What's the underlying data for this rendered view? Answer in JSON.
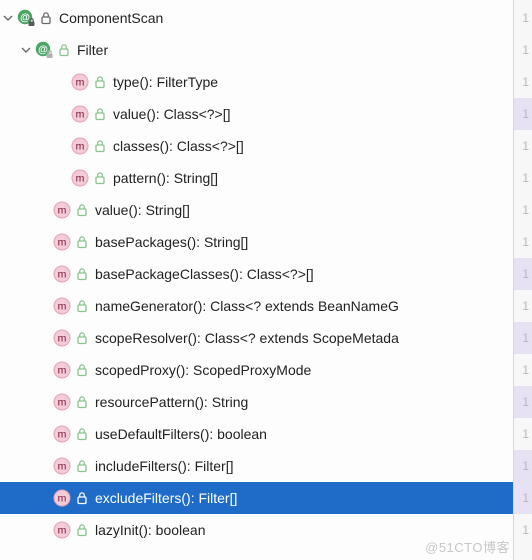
{
  "colors": {
    "selection": "#1e6cc7"
  },
  "gutter_char": "1",
  "watermark": "@51CTO博客",
  "nodes": [
    {
      "indent": 0,
      "caret": "down",
      "kind": "annotation",
      "lock_style": "dark",
      "label": "ComponentScan",
      "selected": false,
      "gutter_hl": false
    },
    {
      "indent": 1,
      "caret": "down",
      "kind": "annotation",
      "lock_style": "light",
      "label": "Filter",
      "selected": false,
      "gutter_hl": false
    },
    {
      "indent": 3,
      "caret": "none",
      "kind": "method",
      "lock_style": "light",
      "label": "type(): FilterType",
      "selected": false,
      "gutter_hl": false
    },
    {
      "indent": 3,
      "caret": "none",
      "kind": "method",
      "lock_style": "light",
      "label": "value(): Class<?>[]",
      "selected": false,
      "gutter_hl": true
    },
    {
      "indent": 3,
      "caret": "none",
      "kind": "method",
      "lock_style": "light",
      "label": "classes(): Class<?>[]",
      "selected": false,
      "gutter_hl": false
    },
    {
      "indent": 3,
      "caret": "none",
      "kind": "method",
      "lock_style": "light",
      "label": "pattern(): String[]",
      "selected": false,
      "gutter_hl": false
    },
    {
      "indent": 2,
      "caret": "none",
      "kind": "method",
      "lock_style": "light",
      "label": "value(): String[]",
      "selected": false,
      "gutter_hl": false
    },
    {
      "indent": 2,
      "caret": "none",
      "kind": "method",
      "lock_style": "light",
      "label": "basePackages(): String[]",
      "selected": false,
      "gutter_hl": false
    },
    {
      "indent": 2,
      "caret": "none",
      "kind": "method",
      "lock_style": "light",
      "label": "basePackageClasses(): Class<?>[]",
      "selected": false,
      "gutter_hl": true
    },
    {
      "indent": 2,
      "caret": "none",
      "kind": "method",
      "lock_style": "light",
      "label": "nameGenerator(): Class<? extends BeanNameG",
      "selected": false,
      "gutter_hl": false
    },
    {
      "indent": 2,
      "caret": "none",
      "kind": "method",
      "lock_style": "light",
      "label": "scopeResolver(): Class<? extends ScopeMetada",
      "selected": false,
      "gutter_hl": true
    },
    {
      "indent": 2,
      "caret": "none",
      "kind": "method",
      "lock_style": "light",
      "label": "scopedProxy(): ScopedProxyMode",
      "selected": false,
      "gutter_hl": false
    },
    {
      "indent": 2,
      "caret": "none",
      "kind": "method",
      "lock_style": "light",
      "label": "resourcePattern(): String",
      "selected": false,
      "gutter_hl": true
    },
    {
      "indent": 2,
      "caret": "none",
      "kind": "method",
      "lock_style": "light",
      "label": "useDefaultFilters(): boolean",
      "selected": false,
      "gutter_hl": false
    },
    {
      "indent": 2,
      "caret": "none",
      "kind": "method",
      "lock_style": "light",
      "label": "includeFilters(): Filter[]",
      "selected": false,
      "gutter_hl": true
    },
    {
      "indent": 2,
      "caret": "none",
      "kind": "method",
      "lock_style": "light",
      "label": "excludeFilters(): Filter[]",
      "selected": true,
      "gutter_hl": true
    },
    {
      "indent": 2,
      "caret": "none",
      "kind": "method",
      "lock_style": "light",
      "label": "lazyInit(): boolean",
      "selected": false,
      "gutter_hl": false
    }
  ]
}
